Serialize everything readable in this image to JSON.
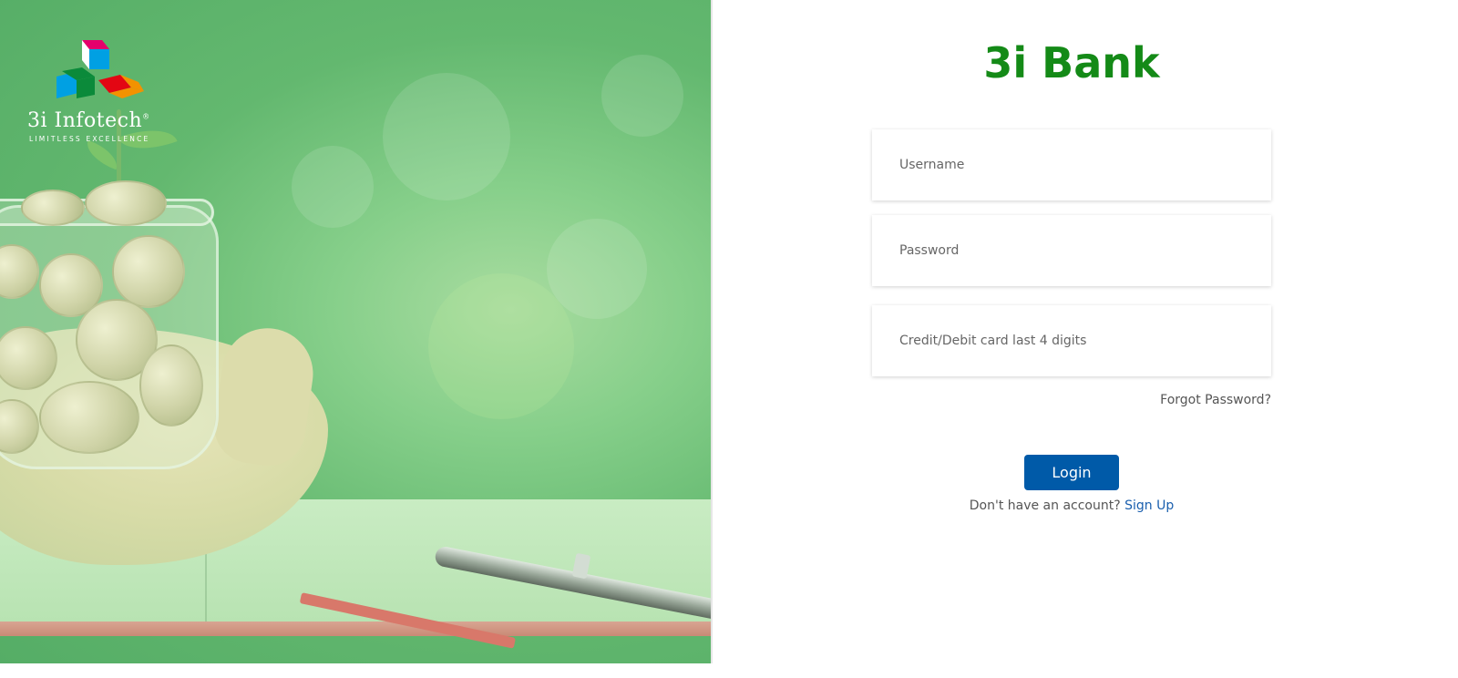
{
  "hero": {
    "logo": {
      "name": "3i Infotech",
      "registered": "®",
      "tagline": "LIMITLESS EXCELLENCE",
      "colors": [
        "#e5006c",
        "#00a0e3",
        "#0b8a3a",
        "#e30613",
        "#f39200"
      ]
    }
  },
  "login": {
    "title": "3i Bank",
    "title_color": "#148a17",
    "username_placeholder": "Username",
    "password_placeholder": "Password",
    "card_placeholder": "Credit/Debit card last 4 digits",
    "forgot_label": "Forgot Password?",
    "login_label": "Login",
    "login_color": "#005aa8",
    "no_account_text": "Don't have an account?",
    "signup_label": "Sign Up"
  }
}
